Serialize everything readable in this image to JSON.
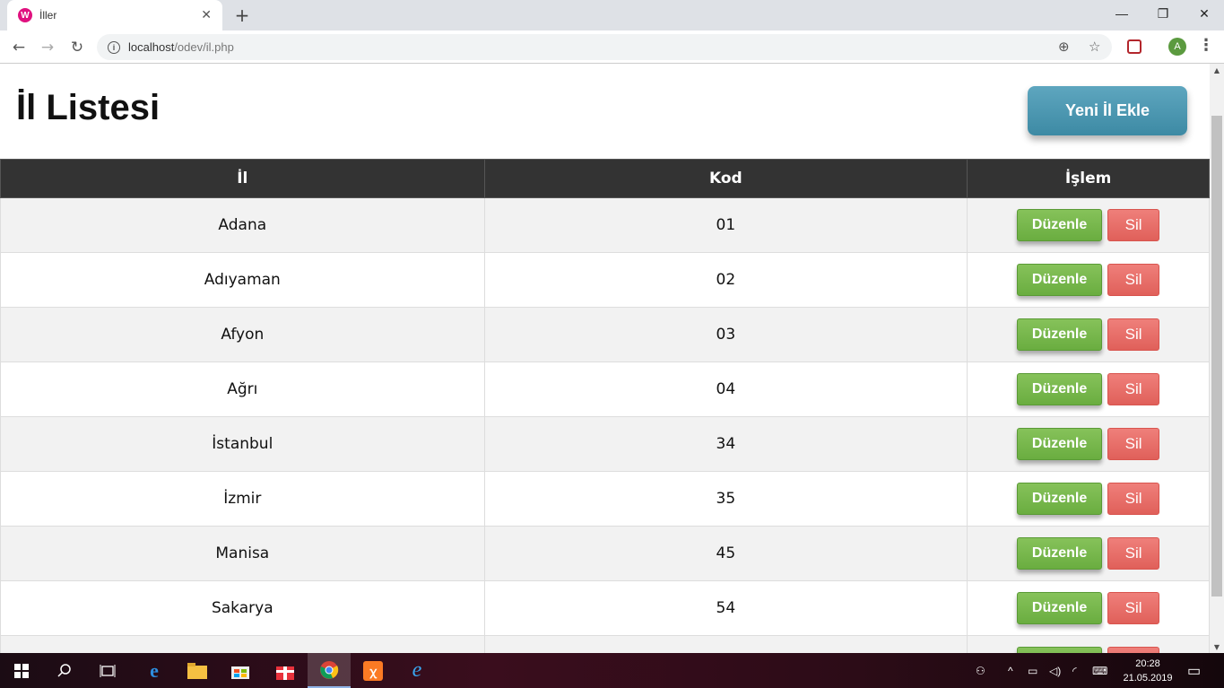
{
  "browser": {
    "tab_title": "İller",
    "tab_favicon": "W",
    "url_host": "localhost",
    "url_path": "/odev/il.php",
    "profile_initial": "A"
  },
  "page": {
    "title": "İl Listesi",
    "add_button": "Yeni İl Ekle"
  },
  "table": {
    "headers": [
      "İl",
      "Kod",
      "İşlem"
    ],
    "rows": [
      {
        "il": "Adana",
        "kod": "01"
      },
      {
        "il": "Adıyaman",
        "kod": "02"
      },
      {
        "il": "Afyon",
        "kod": "03"
      },
      {
        "il": "Ağrı",
        "kod": "04"
      },
      {
        "il": "İstanbul",
        "kod": "34"
      },
      {
        "il": "İzmir",
        "kod": "35"
      },
      {
        "il": "Manisa",
        "kod": "45"
      },
      {
        "il": "Sakarya",
        "kod": "54"
      },
      {
        "il": "",
        "kod": ""
      }
    ],
    "edit_label": "Düzenle",
    "delete_label": "Sil"
  },
  "taskbar": {
    "time": "20:28",
    "date": "21.05.2019"
  },
  "colors": {
    "header_bg": "#333333",
    "add_button": "#4a96b0",
    "edit_button": "#78b84d",
    "delete_button": "#e86e69"
  }
}
